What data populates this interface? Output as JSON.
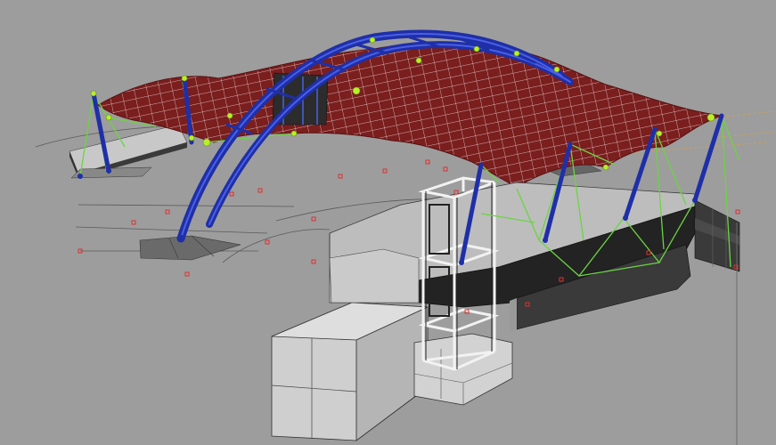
{
  "viewport": {
    "background": "#9d9d9d",
    "colors": {
      "arch": "#1f2fa8",
      "arch_highlight": "#3b4fe0",
      "membrane": "#7a1e1e",
      "membrane_grid": "#f2e6e6",
      "cable": "#6bd442",
      "node": "#b7f02a",
      "block_light": "#d9d9d9",
      "block_mid": "#bdbdbd",
      "block_dark": "#2b2b2b",
      "frame": "#f4f4f4",
      "marker": "#e03030"
    }
  }
}
